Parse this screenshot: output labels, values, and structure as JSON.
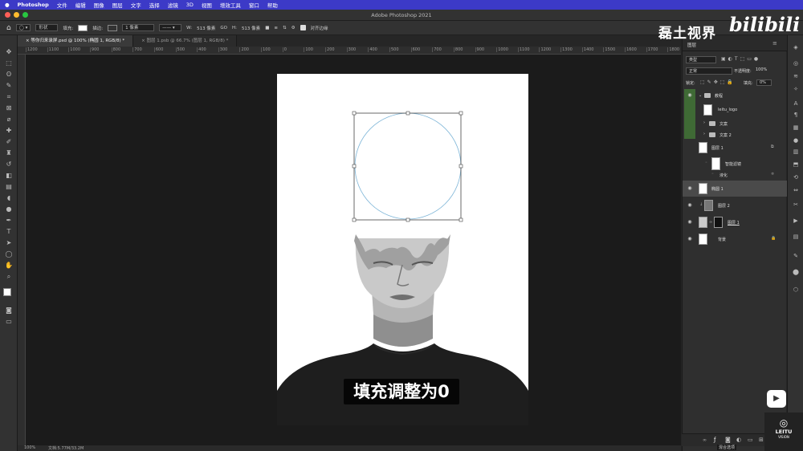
{
  "menubar": {
    "apple": "",
    "app": "Photoshop",
    "items": [
      "文件",
      "编辑",
      "图像",
      "图层",
      "文字",
      "选择",
      "滤镜",
      "3D",
      "视图",
      "增效工具",
      "窗口",
      "帮助"
    ]
  },
  "window": {
    "title": "Adobe Photoshop 2021"
  },
  "options": {
    "mode": "形状",
    "fill_label": "填充:",
    "stroke_label": "描边:",
    "stroke_width": "1 像素",
    "w_label": "W:",
    "w_value": "513 像素",
    "go_label": "GO",
    "h_label": "H:",
    "h_value": "513 像素",
    "align_label": "对齐边缘"
  },
  "tabs": [
    {
      "label": "等你归来录屏.psd @ 100% (椭圆 1, RGB/8) *"
    },
    {
      "label": "图层 1.psb @ 66.7% (图层 1, RGB/8) *"
    }
  ],
  "ruler": {
    "ticks": [
      "1200",
      "1100",
      "1000",
      "900",
      "800",
      "700",
      "600",
      "500",
      "400",
      "300",
      "200",
      "100",
      "0",
      "100",
      "200",
      "300",
      "400",
      "500",
      "600",
      "700",
      "800",
      "900",
      "1000",
      "1100",
      "1200",
      "1300",
      "1400",
      "1500",
      "1600",
      "1700",
      "1800"
    ]
  },
  "status": {
    "zoom": "100%",
    "doc": "文档:5.77M/33.2M"
  },
  "subtitle": "填充调整为0",
  "watermark": {
    "text": "磊土视界",
    "logo": "bilibili",
    "brand": "LEITU",
    "brand_sub": "VISION"
  },
  "layers_panel": {
    "title": "图层",
    "filter": "类型",
    "blend": "正常",
    "opacity_label": "不透明度:",
    "opacity": "100%",
    "lock_label": "锁定:",
    "fill_label": "填充:",
    "fill": "0%",
    "layers": [
      {
        "name": "教程",
        "kind": "group",
        "visible": true,
        "indent": 0
      },
      {
        "name": "leitu_logo",
        "kind": "smart",
        "visible": false,
        "indent": 1
      },
      {
        "name": "文案",
        "kind": "group",
        "visible": false,
        "indent": 1
      },
      {
        "name": "文案 2",
        "kind": "group",
        "visible": false,
        "indent": 1
      },
      {
        "name": "图层 1",
        "kind": "smart",
        "visible": false,
        "indent": 0
      },
      {
        "name": "智能滤镜",
        "kind": "filter",
        "visible": false,
        "indent": 1
      },
      {
        "name": "液化",
        "kind": "effect",
        "visible": false,
        "indent": 1
      },
      {
        "name": "椭圆 1",
        "kind": "shape",
        "visible": true,
        "indent": 0,
        "selected": true
      },
      {
        "name": "图层 2",
        "kind": "pixel",
        "visible": true,
        "indent": 0
      },
      {
        "name": "图层 1",
        "kind": "masked",
        "visible": true,
        "indent": 0
      },
      {
        "name": "背景",
        "kind": "background",
        "visible": true,
        "indent": 0
      }
    ],
    "tooltip": "混合选项"
  },
  "colors": {
    "menubar": "#3c3ac7",
    "selected_layer": "#4a4a4a",
    "visible_group": "#3f6a35"
  }
}
